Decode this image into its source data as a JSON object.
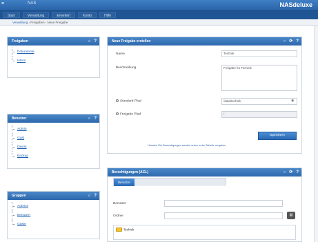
{
  "topbar": {
    "logo": "≡",
    "mini_logo": "NAS",
    "brand": "NASdeluxe"
  },
  "nav": [
    "Start",
    "Verwaltung",
    "Erweitert",
    "Konto",
    "Hilfe"
  ],
  "breadcrumb": {
    "link": "Verwaltung",
    "rest": " › Freigaben › Neue Freigabe"
  },
  "left_panels": [
    {
      "title": "Freigaben",
      "items": [
        "Dokumente",
        "Intern"
      ]
    },
    {
      "title": "Benutzer",
      "items": [
        "Admin",
        "Gast",
        "Dienst",
        "Backup"
      ]
    },
    {
      "title": "Gruppen",
      "items": [
        "Admins",
        "Benutzer",
        "Gäste"
      ]
    }
  ],
  "share_panel": {
    "title": "Neue Freigabe erstellen",
    "name_label": "Name",
    "name_value": "Technik",
    "desc_label": "Beschreibung",
    "desc_value": "Freigabe für Technik",
    "standard_path_label": "Standard Pfad",
    "standard_path_value": "/data/technik",
    "custom_path_label": "Freigabe Pfad",
    "custom_path_value": "/",
    "button": "Speichern",
    "hint": "Hinweis: Die Berechtigungen werden unten in der Tabelle vergeben"
  },
  "acl_panel": {
    "title": "Berechtigungen (ACL)",
    "tab": "Benutzer",
    "user_label": "Benutzer",
    "folder_label": "Ordner",
    "folder_item": "Technik"
  },
  "tools": {
    "collapse": "○",
    "refresh": "⟳",
    "help": "?"
  }
}
